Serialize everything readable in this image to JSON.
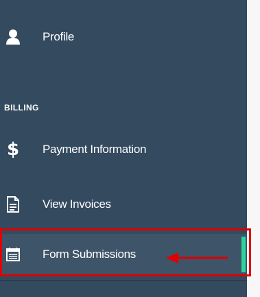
{
  "sidebar": {
    "items": [
      {
        "label": "Profile",
        "icon": "user-icon"
      },
      {
        "label": "Payment Information",
        "icon": "dollar-icon",
        "glyph": "$"
      },
      {
        "label": "View Invoices",
        "icon": "document-icon"
      },
      {
        "label": "Form Submissions",
        "icon": "calendar-icon",
        "active": true
      }
    ],
    "billing_header": "BILLING"
  },
  "colors": {
    "sidebar_bg": "#344a5f",
    "active_bg": "#3e5469",
    "active_indicator": "#2ed39c",
    "annotation_red": "#e00000"
  }
}
